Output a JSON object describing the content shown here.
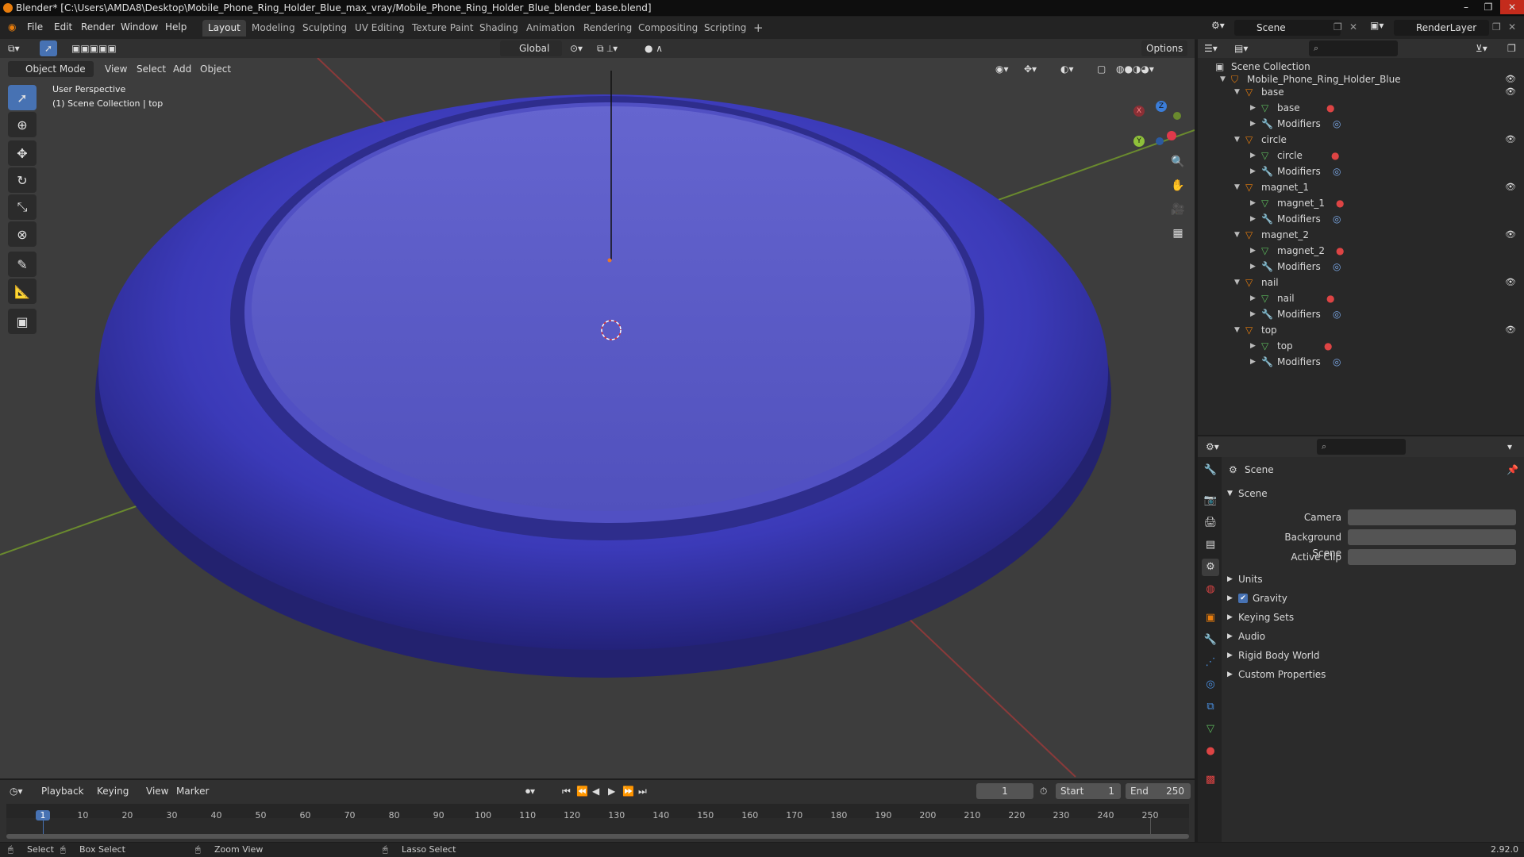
{
  "titlebar": {
    "title": "Blender* [C:\\Users\\AMDA8\\Desktop\\Mobile_Phone_Ring_Holder_Blue_max_vray/Mobile_Phone_Ring_Holder_Blue_blender_base.blend]",
    "minimize": "–",
    "maximize": "❐",
    "close": "✕"
  },
  "menubar": {
    "items": [
      "File",
      "Edit",
      "Render",
      "Window",
      "Help"
    ],
    "tabs": [
      "Layout",
      "Modeling",
      "Sculpting",
      "UV Editing",
      "Texture Paint",
      "Shading",
      "Animation",
      "Rendering",
      "Compositing",
      "Scripting"
    ],
    "add_tab": "+",
    "scene": "Scene",
    "render_layer": "RenderLayer"
  },
  "viewport_header": {
    "transform_orientation": "Global",
    "options": "Options",
    "mode": "Object Mode",
    "menus": [
      "View",
      "Select",
      "Add",
      "Object"
    ]
  },
  "viewport": {
    "perspective": "User Perspective",
    "collection_info": "(1) Scene Collection | top",
    "gizmo": {
      "x": "X",
      "y": "Y",
      "z": "Z"
    },
    "model_color": "#3d3cb0"
  },
  "outliner": {
    "root": "Scene Collection",
    "collection": "Mobile_Phone_Ring_Holder_Blue",
    "objects": [
      {
        "name": "base",
        "mesh": "base",
        "modifiers": "Modifiers"
      },
      {
        "name": "circle",
        "mesh": "circle",
        "modifiers": "Modifiers"
      },
      {
        "name": "magnet_1",
        "mesh": "magnet_1",
        "modifiers": "Modifiers"
      },
      {
        "name": "magnet_2",
        "mesh": "magnet_2",
        "modifiers": "Modifiers"
      },
      {
        "name": "nail",
        "mesh": "nail",
        "modifiers": "Modifiers"
      },
      {
        "name": "top",
        "mesh": "top",
        "modifiers": "Modifiers"
      }
    ]
  },
  "properties": {
    "header": "Scene",
    "section": "Scene",
    "camera_label": "Camera",
    "background_scene_label": "Background Scene",
    "active_clip_label": "Active Clip",
    "panels": [
      "Units",
      "Gravity",
      "Keying Sets",
      "Audio",
      "Rigid Body World",
      "Custom Properties"
    ]
  },
  "timeline": {
    "menus": [
      "Playback",
      "Keying",
      "View",
      "Marker"
    ],
    "current_frame": "1",
    "start_label": "Start",
    "start": "1",
    "end_label": "End",
    "end": "250",
    "ticks": [
      "1",
      "10",
      "20",
      "30",
      "40",
      "50",
      "60",
      "70",
      "80",
      "90",
      "100",
      "110",
      "120",
      "130",
      "140",
      "150",
      "160",
      "170",
      "180",
      "190",
      "200",
      "210",
      "220",
      "230",
      "240",
      "250"
    ]
  },
  "statusbar": {
    "select": "Select",
    "box_select": "Box Select",
    "zoom_view": "Zoom View",
    "lasso_select": "Lasso Select",
    "version": "2.92.0"
  }
}
